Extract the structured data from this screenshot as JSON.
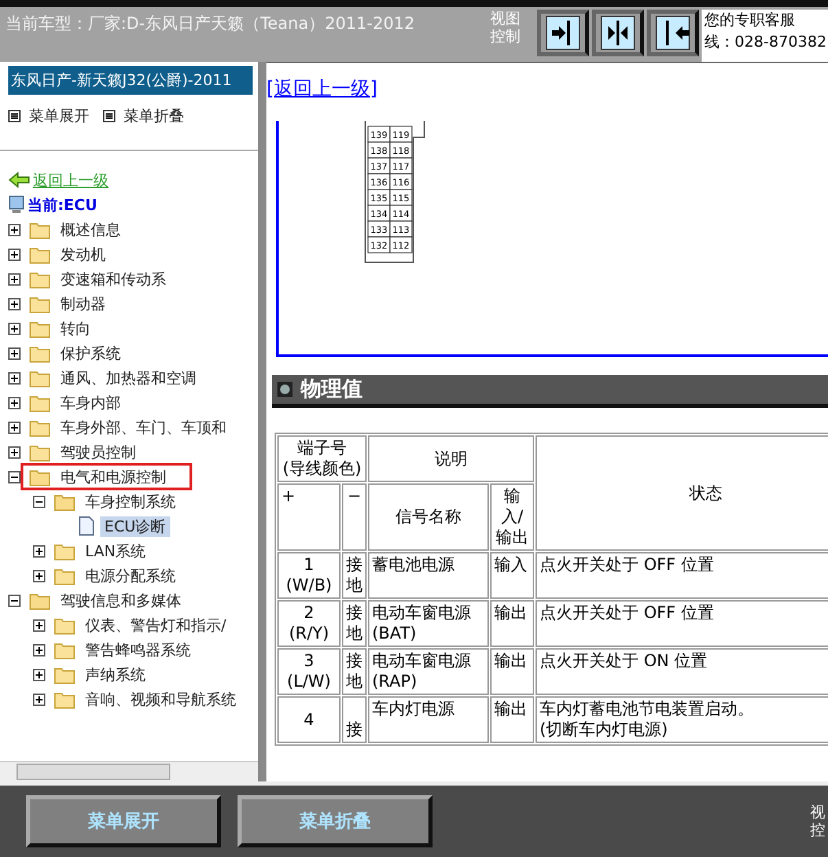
{
  "top_bar": {
    "title": "当前车型：厂家:D-东风日产天籁（Teana）2011-2012",
    "view_label": "视图控制",
    "view_buttons": [
      {
        "kind": "right"
      },
      {
        "kind": "both"
      },
      {
        "kind": "left"
      }
    ],
    "service": {
      "line_1": "您的专职客服",
      "line_2": "线：028-870382"
    }
  },
  "sidebar": {
    "title": "东风日产-新天籁J32(公爵)-2011",
    "expand_all": "菜单展开",
    "collapse_all": "菜单折叠",
    "back_link": "返回上一级",
    "current": "当前:ECU",
    "tree": [
      {
        "label": "概述信息",
        "kind": "folder",
        "expanded": false,
        "highlighted": false,
        "selected": false
      },
      {
        "label": "发动机",
        "kind": "folder",
        "expanded": false,
        "highlighted": false,
        "selected": false
      },
      {
        "label": "变速箱和传动系",
        "kind": "folder",
        "expanded": false,
        "highlighted": false,
        "selected": false
      },
      {
        "label": "制动器",
        "kind": "folder",
        "expanded": false,
        "highlighted": false,
        "selected": false
      },
      {
        "label": "转向",
        "kind": "folder",
        "expanded": false,
        "highlighted": false,
        "selected": false
      },
      {
        "label": "保护系统",
        "kind": "folder",
        "expanded": false,
        "highlighted": false,
        "selected": false
      },
      {
        "label": "通风、加热器和空调",
        "kind": "folder",
        "expanded": false,
        "highlighted": false,
        "selected": false
      },
      {
        "label": "车身内部",
        "kind": "folder",
        "expanded": false,
        "highlighted": false,
        "selected": false
      },
      {
        "label": "车身外部、车门、车顶和",
        "kind": "folder",
        "expanded": false,
        "highlighted": false,
        "selected": false
      },
      {
        "label": "驾驶员控制",
        "kind": "folder",
        "expanded": false,
        "highlighted": false,
        "selected": false
      },
      {
        "label": "电气和电源控制",
        "kind": "folder",
        "expanded": true,
        "highlighted": true,
        "selected": false,
        "children": [
          {
            "label": "车身控制系统",
            "kind": "folder",
            "expanded": true,
            "highlighted": false,
            "selected": false,
            "children": [
              {
                "label": "ECU诊断",
                "kind": "doc",
                "highlighted": false,
                "selected": true
              }
            ]
          },
          {
            "label": "LAN系统",
            "kind": "folder",
            "expanded": false,
            "highlighted": false,
            "selected": false
          },
          {
            "label": "电源分配系统",
            "kind": "folder",
            "expanded": false,
            "highlighted": false,
            "selected": false
          }
        ]
      },
      {
        "label": "驾驶信息和多媒体",
        "kind": "folder",
        "expanded": true,
        "highlighted": false,
        "selected": false,
        "children": [
          {
            "label": "仪表、警告灯和指示/",
            "kind": "folder",
            "expanded": false,
            "highlighted": false,
            "selected": false
          },
          {
            "label": "警告蜂鸣器系统",
            "kind": "folder",
            "expanded": false,
            "highlighted": false,
            "selected": false
          },
          {
            "label": "声纳系统",
            "kind": "folder",
            "expanded": false,
            "highlighted": false,
            "selected": false
          },
          {
            "label": "音响、视频和导航系统",
            "kind": "folder",
            "expanded": false,
            "highlighted": false,
            "selected": false
          }
        ]
      }
    ]
  },
  "content": {
    "back_link": "[返回上一级]",
    "connector_pins": [
      [
        "139",
        "119"
      ],
      [
        "138",
        "118"
      ],
      [
        "137",
        "117"
      ],
      [
        "136",
        "116"
      ],
      [
        "135",
        "115"
      ],
      [
        "134",
        "114"
      ],
      [
        "133",
        "113"
      ],
      [
        "132",
        "112"
      ]
    ],
    "section_title": "物理值",
    "table": {
      "header": {
        "terminal": "端子号\n(导线颜色)",
        "description": "说明",
        "state": "状态",
        "plus": "+",
        "minus": "−",
        "signal": "信号名称",
        "io": "输入/输出"
      },
      "rows": [
        {
          "terminal": "1",
          "wire": "(W/B)",
          "minus": "接地",
          "signal": "蓄电池电源",
          "io": "输入",
          "state": "点火开关处于  OFF 位置"
        },
        {
          "terminal": "2",
          "wire": "(R/Y)",
          "minus": "接地",
          "signal": "电动车窗电源\n(BAT)",
          "io": "输出",
          "state": "点火开关处于  OFF 位置"
        },
        {
          "terminal": "3",
          "wire": "(L/W)",
          "minus": "接地",
          "signal": "电动车窗电源\n(RAP)",
          "io": "输出",
          "state": "点火开关处于  ON 位置"
        },
        {
          "terminal": "4",
          "minus": "接",
          "signal": "车内灯电源",
          "io": "输出",
          "state": "车内灯蓄电池节电装置启动。\n(切断车内灯电源)"
        }
      ]
    }
  },
  "bottom_bar": {
    "buttons": [
      "菜单展开",
      "菜单折叠"
    ],
    "side_label": [
      "视",
      "控"
    ]
  }
}
